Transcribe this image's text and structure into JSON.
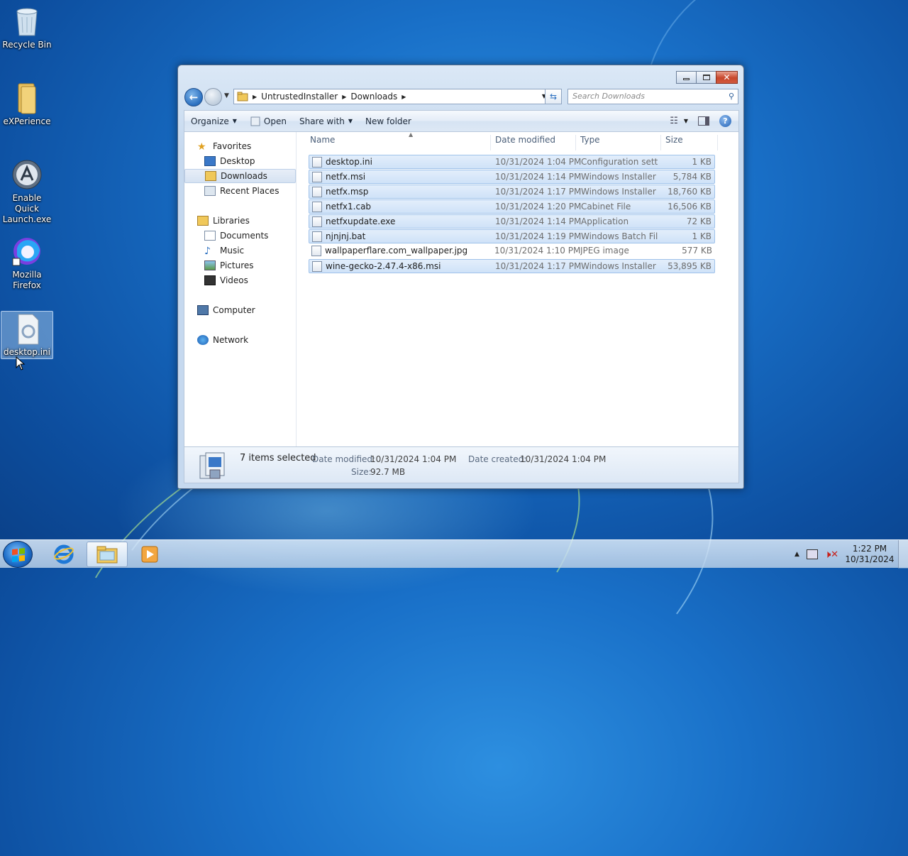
{
  "desktop": {
    "icons": [
      {
        "label": "Recycle Bin"
      },
      {
        "label": "eXPerience"
      },
      {
        "label": "Enable Quick Launch.exe"
      },
      {
        "label": "Mozilla Firefox"
      },
      {
        "label": "desktop.ini"
      }
    ]
  },
  "window": {
    "address": {
      "segments": [
        "UntrustedInstaller",
        "Downloads"
      ]
    },
    "search_placeholder": "Search Downloads",
    "toolbar": {
      "organize": "Organize",
      "open": "Open",
      "share_with": "Share with",
      "new_folder": "New folder"
    },
    "nav": {
      "favorites": "Favorites",
      "desktop": "Desktop",
      "downloads": "Downloads",
      "recent_places": "Recent Places",
      "libraries": "Libraries",
      "documents": "Documents",
      "music": "Music",
      "pictures": "Pictures",
      "videos": "Videos",
      "computer": "Computer",
      "network": "Network"
    },
    "columns": {
      "name": "Name",
      "date": "Date modified",
      "type": "Type",
      "size": "Size"
    },
    "files": [
      {
        "name": "desktop.ini",
        "date": "10/31/2024 1:04 PM",
        "type": "Configuration sett...",
        "size": "1 KB",
        "selected": true
      },
      {
        "name": "netfx.msi",
        "date": "10/31/2024 1:14 PM",
        "type": "Windows Installer ...",
        "size": "5,784 KB",
        "selected": true
      },
      {
        "name": "netfx.msp",
        "date": "10/31/2024 1:17 PM",
        "type": "Windows Installer ...",
        "size": "18,760 KB",
        "selected": true
      },
      {
        "name": "netfx1.cab",
        "date": "10/31/2024 1:20 PM",
        "type": "Cabinet File",
        "size": "16,506 KB",
        "selected": true
      },
      {
        "name": "netfxupdate.exe",
        "date": "10/31/2024 1:14 PM",
        "type": "Application",
        "size": "72 KB",
        "selected": true
      },
      {
        "name": "njnjnj.bat",
        "date": "10/31/2024 1:19 PM",
        "type": "Windows Batch File",
        "size": "1 KB",
        "selected": true
      },
      {
        "name": "wallpaperflare.com_wallpaper.jpg",
        "date": "10/31/2024 1:10 PM",
        "type": "JPEG image",
        "size": "577 KB",
        "selected": false
      },
      {
        "name": "wine-gecko-2.47.4-x86.msi",
        "date": "10/31/2024 1:17 PM",
        "type": "Windows Installer ...",
        "size": "53,895 KB",
        "selected": true
      }
    ],
    "details": {
      "count": "7 items selected",
      "date_modified_label": "Date modified:",
      "date_modified": "10/31/2024 1:04 PM",
      "date_created_label": "Date created:",
      "date_created": "10/31/2024 1:04 PM",
      "size_label": "Size:",
      "size": "92.7 MB"
    }
  },
  "taskbar": {
    "time": "1:22 PM",
    "date": "10/31/2024"
  },
  "colors": {
    "accent": "#1f6fc9",
    "selection": "#cfe2f8",
    "close": "#c8472c"
  }
}
